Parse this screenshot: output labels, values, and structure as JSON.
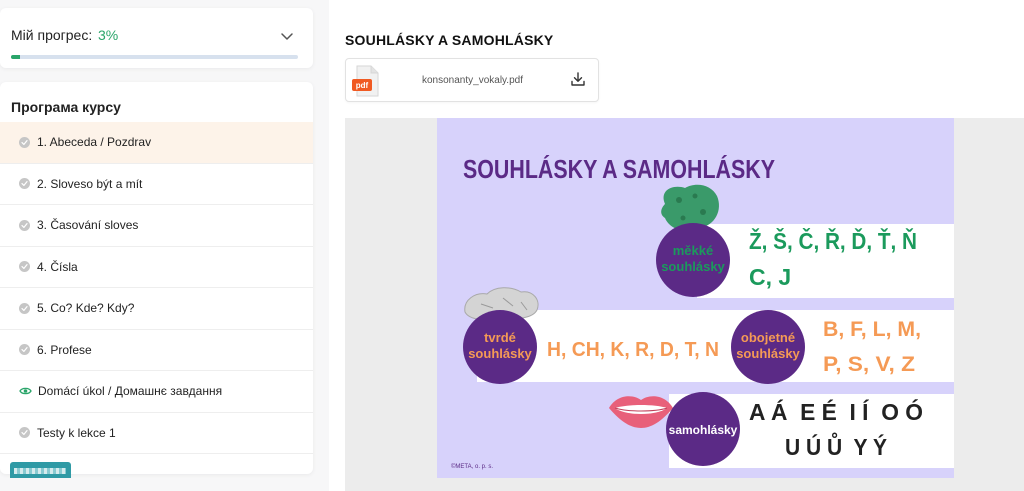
{
  "progress": {
    "label": "Мій прогрес:",
    "value": "3%",
    "fraction": 0.03,
    "accent": "#2aa56a"
  },
  "program": {
    "title": "Програма курсу",
    "lessons": [
      {
        "label": "1. Abeceda / Pozdrav",
        "icon": "check-icon",
        "active": true
      },
      {
        "label": "2. Sloveso být a mít",
        "icon": "check-icon"
      },
      {
        "label": "3. Časování sloves",
        "icon": "check-icon"
      },
      {
        "label": "4. Čísla",
        "icon": "check-icon"
      },
      {
        "label": "5. Co? Kde? Kdy?",
        "icon": "check-icon"
      },
      {
        "label": "6. Profese",
        "icon": "check-icon"
      },
      {
        "label": "Domácí úkol / Домашнє завдання",
        "icon": "eye-icon"
      },
      {
        "label": "Testy k lekce 1",
        "icon": "check-icon"
      }
    ]
  },
  "main": {
    "title": "SOUHLÁSKY A SAMOHLÁSKY",
    "file": {
      "name": "konsonanty_vokaly.pdf",
      "badge": "pdf"
    }
  },
  "slide": {
    "title": "SOUHLÁSKY A SAMOHLÁSKY",
    "soft": {
      "label_1": "měkké",
      "label_2": "souhlásky",
      "letters_1": "Ž, Š, Č, Ř, Ď, Ť, Ň",
      "letters_2": "C, J"
    },
    "hard": {
      "label_1": "tvrdé",
      "label_2": "souhlásky",
      "letters": "H, CH, K, R, D, T, N"
    },
    "ambiguous": {
      "label_1": "obojetné",
      "label_2": "souhlásky",
      "letters_1": "B, F, L, M,",
      "letters_2": "P, S, V, Z"
    },
    "vowels": {
      "label": "samohlásky",
      "letters_1": "A Á  E É  I Í  O Ó",
      "letters_2": "U Ú Ů  Y Ý"
    },
    "footer": "©META, o. p. s.",
    "colors": {
      "background": "#d7d2fb",
      "purple": "#5b2a86",
      "green": "#1b9a5c",
      "orange": "#f59a55"
    }
  }
}
